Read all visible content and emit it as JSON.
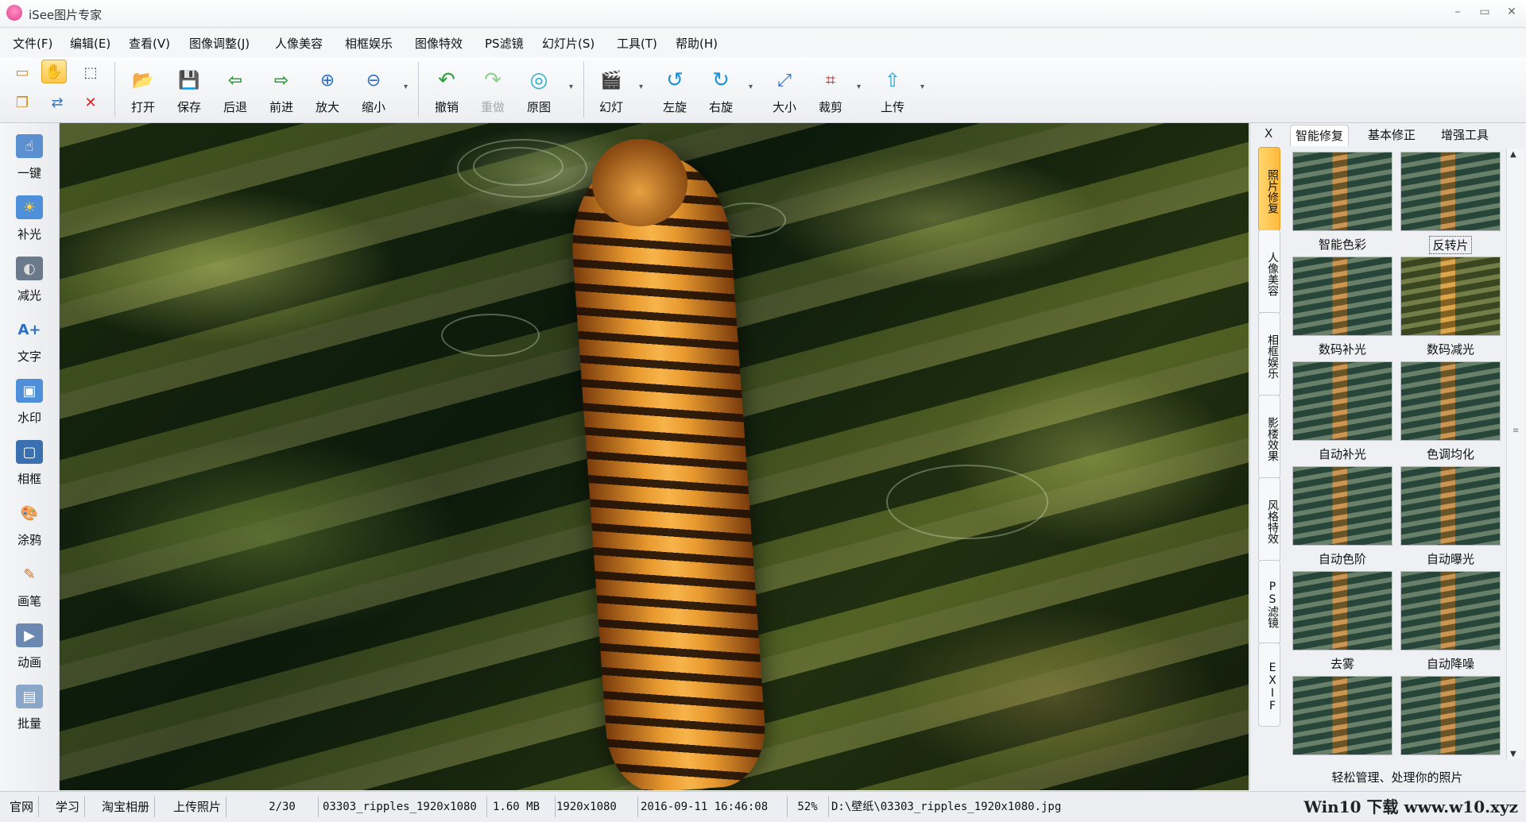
{
  "window": {
    "title": "iSee图片专家",
    "controls": [
      "–",
      "▭",
      "✕"
    ]
  },
  "menu": [
    "文件(F)",
    "编辑(E)",
    "查看(V)",
    "图像调整(J)",
    "人像美容",
    "相框娱乐",
    "图像特效",
    "PS滤镜",
    "幻灯片(S)",
    "工具(T)",
    "帮助(H)"
  ],
  "toolbar": {
    "open": "打开",
    "save": "保存",
    "back": "后退",
    "forward": "前进",
    "zoom_in": "放大",
    "zoom_out": "缩小",
    "undo": "撤销",
    "redo": "重做",
    "original": "原图",
    "slideshow": "幻灯",
    "rotate_left": "左旋",
    "rotate_right": "右旋",
    "resize": "大小",
    "crop": "裁剪",
    "upload": "上传"
  },
  "left_tools": [
    "一键",
    "补光",
    "减光",
    "文字",
    "水印",
    "相框",
    "涂鸦",
    "画笔",
    "动画",
    "批量"
  ],
  "right_panel": {
    "close": "X",
    "vertical_tabs": [
      "照片修复",
      "人像美容",
      "相框娱乐",
      "影楼效果",
      "风格特效",
      "PS滤镜",
      "EXIF"
    ],
    "tabs": [
      "智能修复",
      "基本修正",
      "增强工具"
    ],
    "thumbnails": [
      "智能色彩",
      "反转片",
      "数码补光",
      "数码减光",
      "自动补光",
      "色调均化",
      "自动色阶",
      "自动曝光",
      "去雾",
      "自动降噪",
      "",
      ""
    ],
    "footer": "轻松管理、处理你的照片"
  },
  "status": {
    "links": [
      "官网",
      "学习",
      "淘宝相册",
      "上传照片"
    ],
    "index": "2/30",
    "filename": "03303_ripples_1920x1080",
    "filesize": "1.60 MB",
    "dimensions": "1920x1080",
    "datetime": "2016-09-11 16:46:08",
    "zoom": "52%",
    "path": "D:\\壁纸\\03303_ripples_1920x1080.jpg"
  },
  "watermark": "Win10 下载 www.w10.xyz"
}
